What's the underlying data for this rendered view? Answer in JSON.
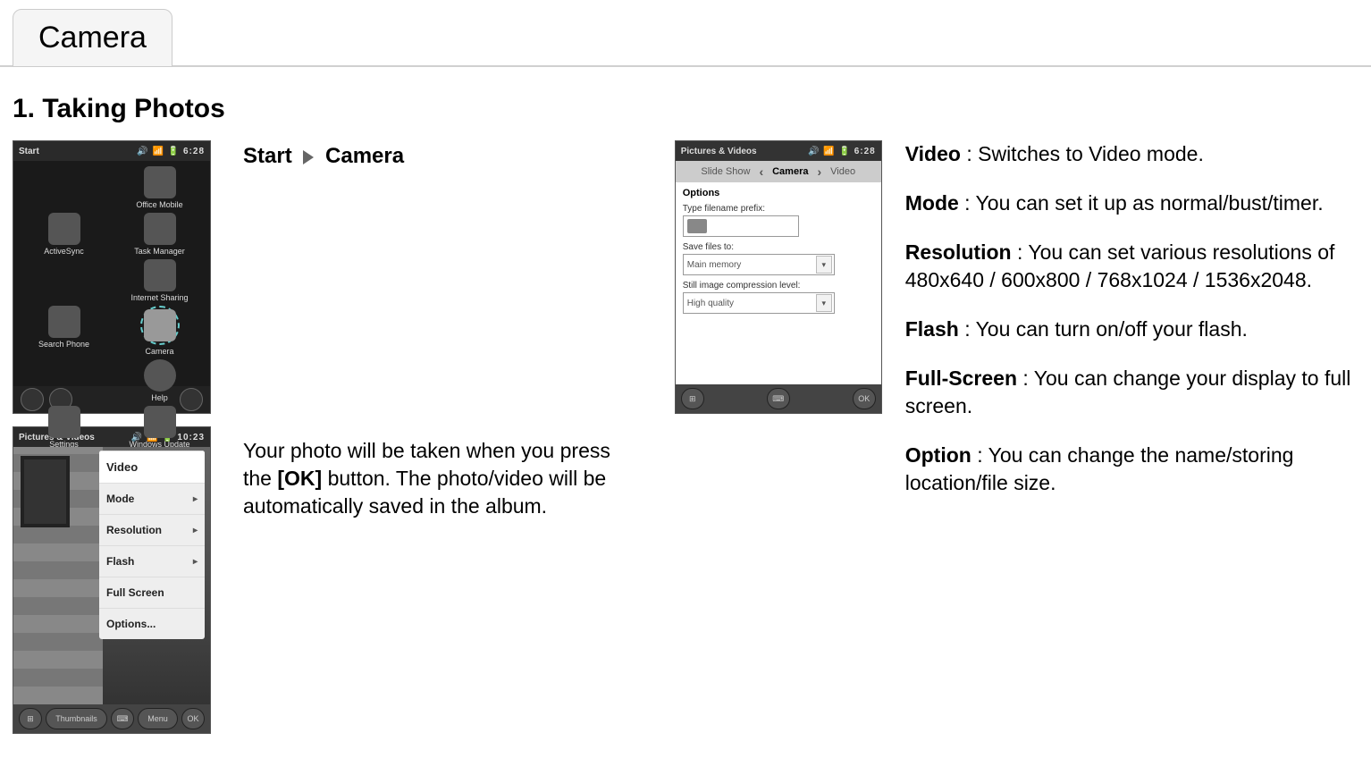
{
  "page": {
    "tab_title": "Camera",
    "section_heading": "1. Taking Photos"
  },
  "breadcrumb": {
    "item1": "Start",
    "item2": "Camera"
  },
  "left_text": {
    "p1_pre": "Your photo will be taken when you press the ",
    "p1_bold": "[OK]",
    "p1_post": " button. The photo/video will be automatically saved in the album."
  },
  "right_defs": {
    "video": {
      "term": "Video",
      "desc": " : Switches to Video mode."
    },
    "mode": {
      "term": "Mode",
      "desc": " : You can set it up as normal/bust/timer."
    },
    "resolution": {
      "term": "Resolution",
      "desc": " : You can set various resolutions of 480x640 / 600x800 / 768x1024 / 1536x2048."
    },
    "flash": {
      "term": "Flash",
      "desc": " : You can turn on/off your flash."
    },
    "fullscreen": {
      "term": "Full-Screen",
      "desc": " : You can change your display to full screen."
    },
    "option": {
      "term": "Option",
      "desc": " : You can change the name/storing location/file size."
    }
  },
  "ss1": {
    "title": "Start",
    "status_icons": "🔊 📶 🔋 6:28",
    "items": {
      "i0": "Office Mobile",
      "i1": "ActiveSync",
      "i2": "Task Manager",
      "i3": "Internet Sharing",
      "i4": "Search Phone",
      "i5": "Camera",
      "i6": "Help",
      "i7": "Settings",
      "i8": "Windows Update"
    }
  },
  "ss2": {
    "title": "Pictures & Videos",
    "status_icons": "🔊 📶 🔋 10:23",
    "menu": {
      "m0": "Video",
      "m1": "Mode",
      "m2": "Resolution",
      "m3": "Flash",
      "m4": "Full Screen",
      "m5": "Options..."
    },
    "soft_left": "Thumbnails",
    "soft_right": "Menu",
    "soft_ok": "OK"
  },
  "ss3": {
    "title": "Pictures & Videos",
    "status_icons": "🔊 📶 🔋 6:28",
    "tab_left": "Slide Show",
    "tab_center": "Camera",
    "tab_right": "Video",
    "form_heading": "Options",
    "label_prefix": "Type filename prefix:",
    "label_saveto": "Save files to:",
    "value_saveto": "Main memory",
    "label_compression": "Still image compression level:",
    "value_compression": "High quality",
    "btn_ok": "OK"
  }
}
